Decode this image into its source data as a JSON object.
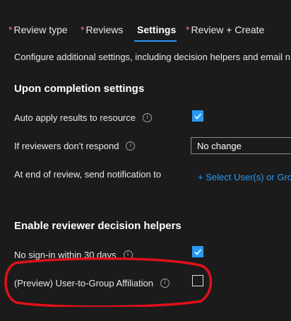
{
  "tabs": [
    {
      "label": "Review type",
      "required": true,
      "required_mark": "*"
    },
    {
      "label": "Reviews",
      "required": true,
      "required_mark": "*"
    },
    {
      "label": "Settings",
      "required": false,
      "active": true
    },
    {
      "label": "Review + Create",
      "required": true,
      "required_mark": "*"
    }
  ],
  "description": "Configure additional settings, including decision helpers and email n",
  "completion": {
    "title": "Upon completion settings",
    "auto_apply_label": "Auto apply results to resource",
    "auto_apply_checked": true,
    "no_respond_label": "If reviewers don't respond",
    "no_respond_value": "No change",
    "end_notify_label": "At end of review, send notification to",
    "select_users_link": "+ Select User(s) or Grou"
  },
  "helpers": {
    "title": "Enable reviewer decision helpers",
    "no_signin_label": "No sign-in within 30 days",
    "no_signin_checked": true,
    "preview_label": "(Preview) User-to-Group Affiliation",
    "preview_checked": false
  },
  "icons": {
    "info": "info-circle-icon",
    "check": "checkmark-icon"
  },
  "colors": {
    "accent": "#2899f5",
    "required": "#f1707b",
    "annotation": "#e0101a",
    "background": "#1b1b1b"
  }
}
